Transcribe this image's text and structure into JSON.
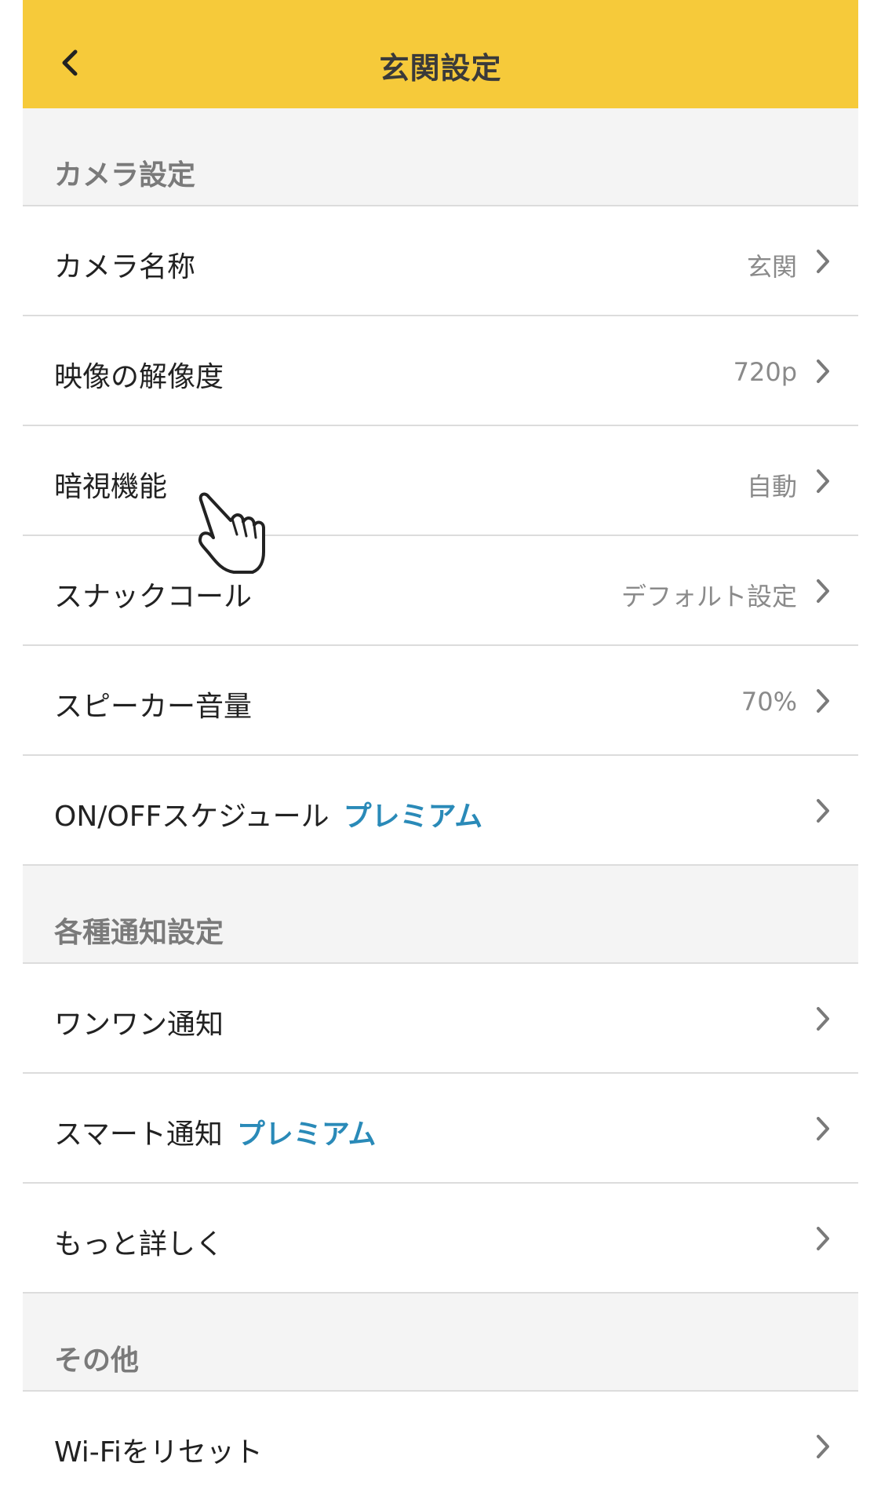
{
  "header": {
    "title": "玄関設定",
    "back_icon": "chevron-left-icon"
  },
  "sections": [
    {
      "label": "カメラ設定",
      "items": [
        {
          "label": "カメラ名称",
          "value": "玄関"
        },
        {
          "label": "映像の解像度",
          "value": "720p"
        },
        {
          "label": "暗視機能",
          "value": "自動"
        },
        {
          "label": "スナックコール",
          "value": "デフォルト設定"
        },
        {
          "label": "スピーカー音量",
          "value": "70%"
        },
        {
          "label": "ON/OFFスケジュール",
          "badge": "プレミアム"
        }
      ]
    },
    {
      "label": "各種通知設定",
      "items": [
        {
          "label": "ワンワン通知"
        },
        {
          "label": "スマート通知",
          "badge": "プレミアム"
        },
        {
          "label": "もっと詳しく"
        }
      ]
    },
    {
      "label": "その他",
      "items": [
        {
          "label": "Wi-Fiをリセット"
        }
      ]
    }
  ],
  "colors": {
    "header_bg": "#f6ca3a",
    "premium": "#2a8ab8",
    "section_bg": "#f4f4f4",
    "value_text": "#8a8a8a"
  },
  "icons": {
    "chevron": "chevron-right-icon",
    "cursor": "hand-pointer-icon"
  }
}
